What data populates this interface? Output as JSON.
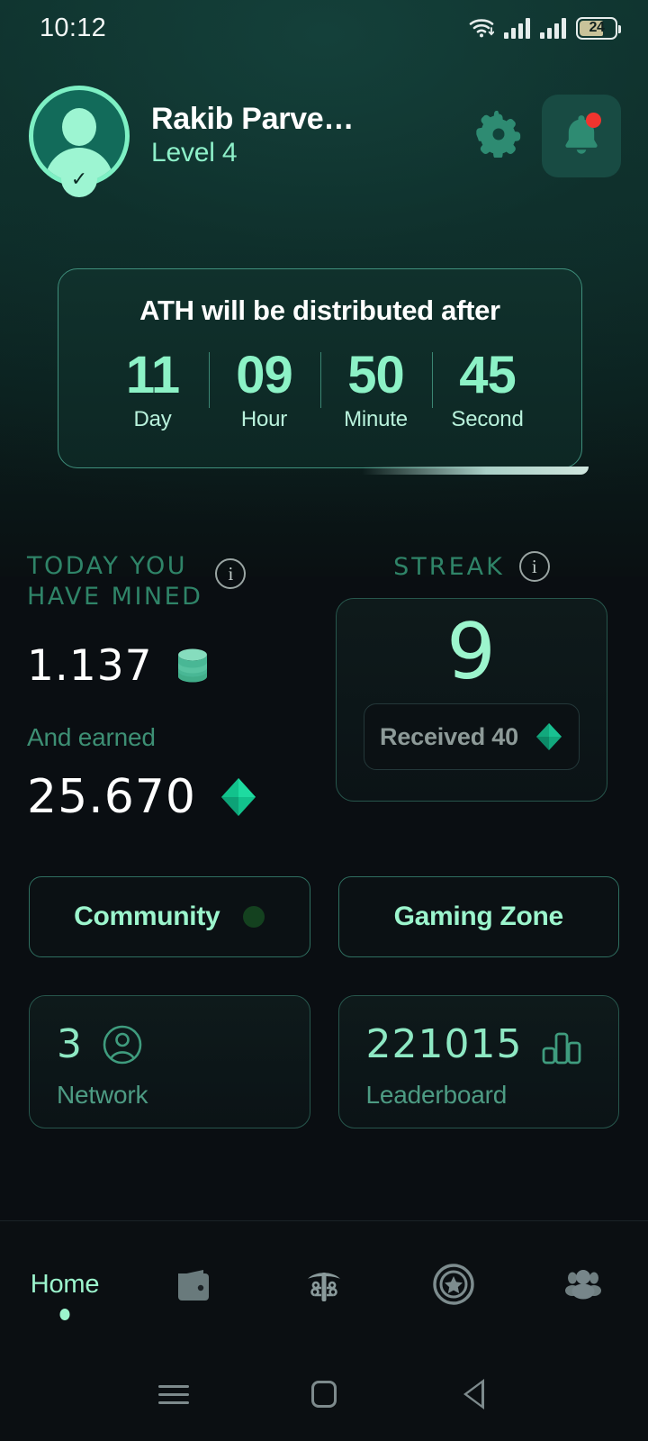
{
  "statusbar": {
    "time": "10:12",
    "battery_percent": "24",
    "wifi_icon": "wifi-icon",
    "signal_icon": "signal-bars-icon"
  },
  "header": {
    "username": "Rakib Parve…",
    "level": "Level 4",
    "avatar_icon": "avatar-person-icon",
    "verified_icon": "check-badge-icon",
    "settings_icon": "gear-icon",
    "notifications_icon": "bell-icon",
    "has_notification": true
  },
  "countdown": {
    "title": "ATH will be distributed after",
    "units": [
      {
        "value": "11",
        "label": "Day"
      },
      {
        "value": "09",
        "label": "Hour"
      },
      {
        "value": "50",
        "label": "Minute"
      },
      {
        "value": "45",
        "label": "Second"
      }
    ]
  },
  "mined": {
    "title": "TODAY YOU\nHAVE MINED",
    "title_line1": "TODAY YOU",
    "title_line2": "HAVE MINED",
    "info_icon": "info-icon",
    "mined_value": "1.137",
    "token_icon": "coin-stack-icon",
    "earned_label": "And earned",
    "earned_value": "25.670",
    "gem_icon": "diamond-icon"
  },
  "streak": {
    "title": "STREAK",
    "info_icon": "info-icon",
    "value": "9",
    "received_label": "Received 40",
    "gem_icon": "diamond-icon"
  },
  "actions": [
    {
      "label": "Community",
      "has_dot": true
    },
    {
      "label": "Gaming Zone",
      "has_dot": false
    }
  ],
  "stats": [
    {
      "value": "3",
      "label": "Network",
      "icon": "user-circle-icon"
    },
    {
      "value": "221015",
      "label": "Leaderboard",
      "icon": "bar-chart-icon"
    }
  ],
  "bottomnav": [
    {
      "label": "Home",
      "icon": "home-label",
      "active": true
    },
    {
      "label": "",
      "icon": "wallet-icon",
      "active": false
    },
    {
      "label": "",
      "icon": "pickaxe-mining-icon",
      "active": false
    },
    {
      "label": "",
      "icon": "star-badge-icon",
      "active": false
    },
    {
      "label": "",
      "icon": "people-icon",
      "active": false
    }
  ],
  "softkeys": [
    {
      "icon": "menu-icon"
    },
    {
      "icon": "home-square-icon"
    },
    {
      "icon": "back-triangle-icon"
    }
  ],
  "colors": {
    "accent_mint": "#9cf5cd",
    "accent_teal": "#2f8468",
    "bg_dark": "#0a0e12",
    "bg_teal": "#0e322d",
    "notification_red": "#f0342e",
    "gem_green": "#13c08a"
  }
}
